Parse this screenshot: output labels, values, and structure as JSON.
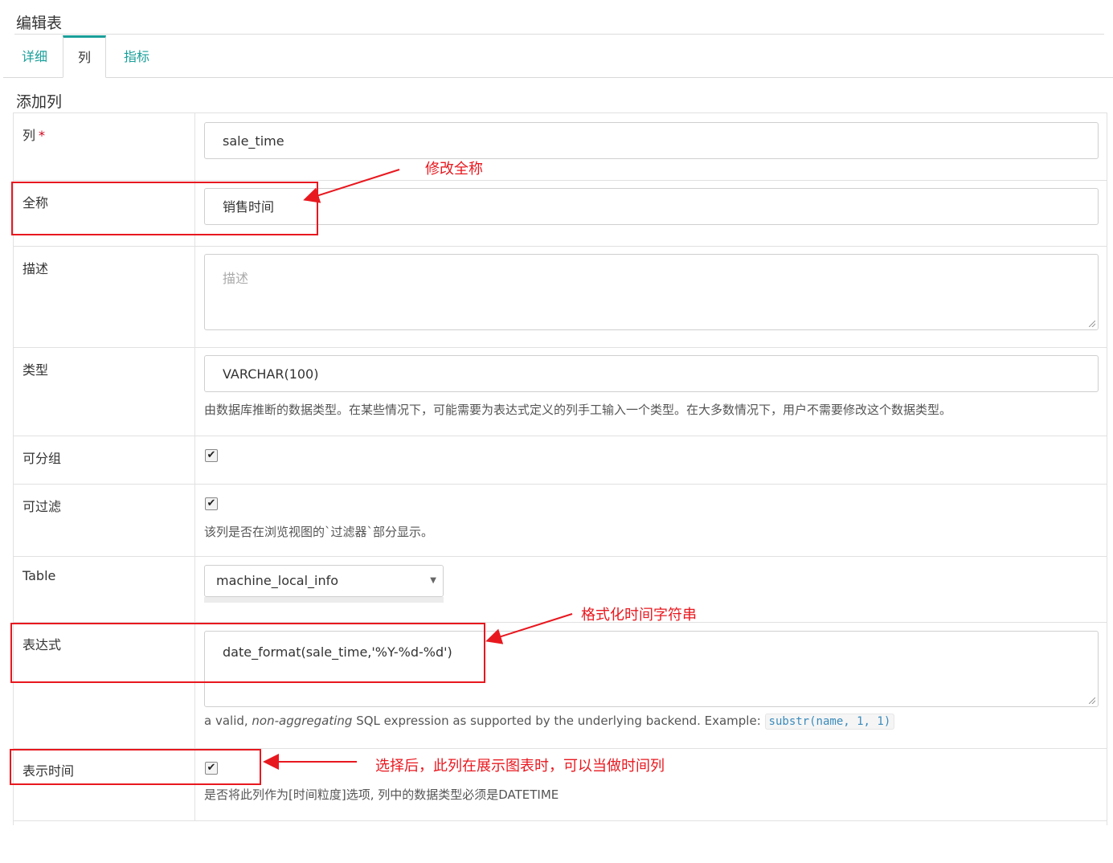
{
  "page_title": "编辑表",
  "tabs": [
    {
      "label": "详细",
      "active": false
    },
    {
      "label": "列",
      "active": true
    },
    {
      "label": "指标",
      "active": false
    }
  ],
  "section_title": "添加列",
  "form": {
    "column": {
      "label": "列",
      "required_mark": "*",
      "value": "sale_time"
    },
    "verbose_name": {
      "label": "全称",
      "value": "销售时间"
    },
    "description": {
      "label": "描述",
      "placeholder": "描述"
    },
    "type": {
      "label": "类型",
      "value": "VARCHAR(100)",
      "help": "由数据库推断的数据类型。在某些情况下，可能需要为表达式定义的列手工输入一个类型。在大多数情况下，用户不需要修改这个数据类型。"
    },
    "groupby": {
      "label": "可分组",
      "checked": true
    },
    "filterable": {
      "label": "可过滤",
      "checked": true,
      "help": "该列是否在浏览视图的`过滤器`部分显示。"
    },
    "table": {
      "label": "Table",
      "value": "machine_local_info"
    },
    "expression": {
      "label": "表达式",
      "value": "date_format(sale_time,'%Y-%d-%d')",
      "help_prefix": "a valid, ",
      "help_italic": "non-aggregating",
      "help_suffix": " SQL expression as supported by the underlying backend. Example: ",
      "help_code": "substr(name, 1, 1)"
    },
    "is_dttm": {
      "label": "表示时间",
      "checked": true,
      "help": "是否将此列作为[时间粒度]选项, 列中的数据类型必须是DATETIME"
    }
  },
  "annotations": {
    "verbose_name": "修改全称",
    "expression": "格式化时间字符串",
    "is_dttm": "选择后，此列在展示图表时，可以当做时间列"
  },
  "colors": {
    "accent": "#1aa09a",
    "annotation": "#e8181f",
    "required": "#d0021b"
  }
}
